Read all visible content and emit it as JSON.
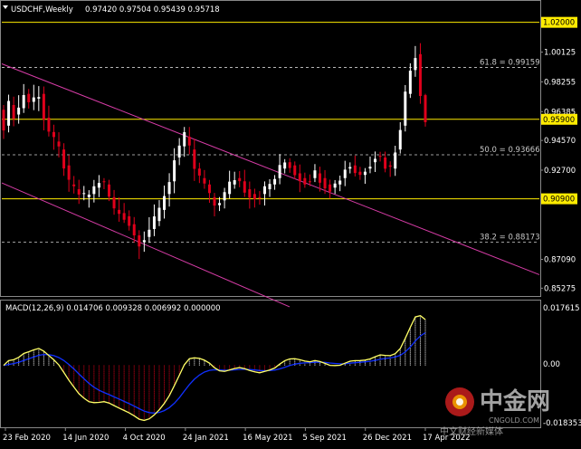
{
  "header": {
    "symbol": "USDCHF,Weekly",
    "ohlc": "0.97420 0.97504 0.95439 0.95718"
  },
  "macd": {
    "label": "MACD(12,26,9) 0.014706 0.009328 0.006992 0.000000",
    "y_top": "0.017615",
    "y_zero": "0.00",
    "y_bottom": "-0.018353"
  },
  "watermark": {
    "brand_cn": "中金网",
    "tagline_cn": "中文财经新媒体",
    "domain": "CNGOLD.COM"
  },
  "colors": {
    "background": "#000000",
    "bull": "#ffffff",
    "bear": "#e0001b",
    "channel": "#d63ca6",
    "level_line": "#ffeb00",
    "price_box": "#ffeb00",
    "macd_line": "#ffff66",
    "signal_line": "#1030ff"
  },
  "chart_data": {
    "type": "candlestick",
    "symbol": "USDCHF",
    "timeframe": "Weekly",
    "ylim": [
      0.8484,
      1.0238
    ],
    "y_ticks": [
      "1.02000",
      "1.00125",
      "0.98255",
      "0.96385",
      "0.94570",
      "0.92700",
      "0.90900",
      "0.87090",
      "0.85275"
    ],
    "x_labels": [
      "23 Feb 2020",
      "14 Jun 2020",
      "4 Oct 2020",
      "24 Jan 2021",
      "16 May 2021",
      "5 Sep 2021",
      "26 Dec 2021",
      "17 Apr 2022"
    ],
    "fib_levels": [
      {
        "label": "61.8 = 0.99159",
        "value": 0.99159
      },
      {
        "label": "50.0 = 0.93666",
        "value": 0.93666
      },
      {
        "label": "38.2 = 0.88173",
        "value": 0.88173
      }
    ],
    "highlighted_levels": [
      {
        "label": "1.02000",
        "value": 1.02
      },
      {
        "label": "0.95900",
        "value": 0.959
      },
      {
        "label": "0.90900",
        "value": 0.909
      }
    ],
    "channel": {
      "upper": [
        {
          "x": "23 Feb 2020",
          "y": 0.993
        },
        {
          "x": "5 Sep 2021",
          "y": 0.919
        }
      ],
      "lower": [
        {
          "x": "23 Feb 2020",
          "y": 0.918
        },
        {
          "x": "16 May 2021",
          "y": 0.853
        }
      ]
    },
    "close_path": [
      0.955,
      0.968,
      0.962,
      0.966,
      0.975,
      0.97,
      0.972,
      0.975,
      0.96,
      0.951,
      0.945,
      0.94,
      0.93,
      0.918,
      0.915,
      0.912,
      0.91,
      0.912,
      0.916,
      0.92,
      0.918,
      0.91,
      0.902,
      0.9,
      0.898,
      0.893,
      0.886,
      0.882,
      0.885,
      0.89,
      0.895,
      0.902,
      0.912,
      0.92,
      0.935,
      0.942,
      0.948,
      0.94,
      0.928,
      0.922,
      0.918,
      0.91,
      0.905,
      0.908,
      0.912,
      0.918,
      0.922,
      0.92,
      0.915,
      0.912,
      0.91,
      0.912,
      0.915,
      0.918,
      0.922,
      0.928,
      0.932,
      0.93,
      0.925,
      0.922,
      0.92,
      0.922,
      0.925,
      0.922,
      0.918,
      0.916,
      0.918,
      0.922,
      0.928,
      0.93,
      0.926,
      0.924,
      0.928,
      0.932,
      0.936,
      0.935,
      0.93,
      0.928,
      0.94,
      0.955,
      0.975,
      0.99,
      1.0,
      0.975,
      0.957
    ],
    "last_price": {
      "open": 0.9742,
      "high": 0.97504,
      "low": 0.95439,
      "close": 0.95718
    }
  }
}
